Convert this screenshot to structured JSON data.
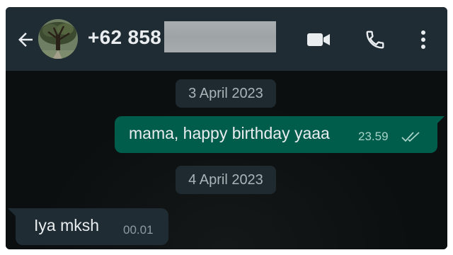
{
  "header": {
    "contact_name": "+62 858",
    "icons": {
      "back": "arrow-left-icon",
      "video": "video-camera-icon",
      "call": "phone-icon",
      "more": "more-vertical-icon"
    }
  },
  "messages": [
    {
      "type": "date",
      "text": "3 April 2023"
    },
    {
      "type": "outgoing",
      "text": "mama, happy birthday yaaa",
      "time": "23.59",
      "status": "read"
    },
    {
      "type": "date",
      "text": "4 April 2023"
    },
    {
      "type": "incoming",
      "text": "Iya mksh",
      "time": "00.01"
    }
  ],
  "colors": {
    "header_bg": "#1f2c33",
    "chat_bg": "#0b0f10",
    "outgoing_bubble": "#005c4b",
    "incoming_bubble": "#1f2c33",
    "date_chip": "#1f2a30"
  }
}
